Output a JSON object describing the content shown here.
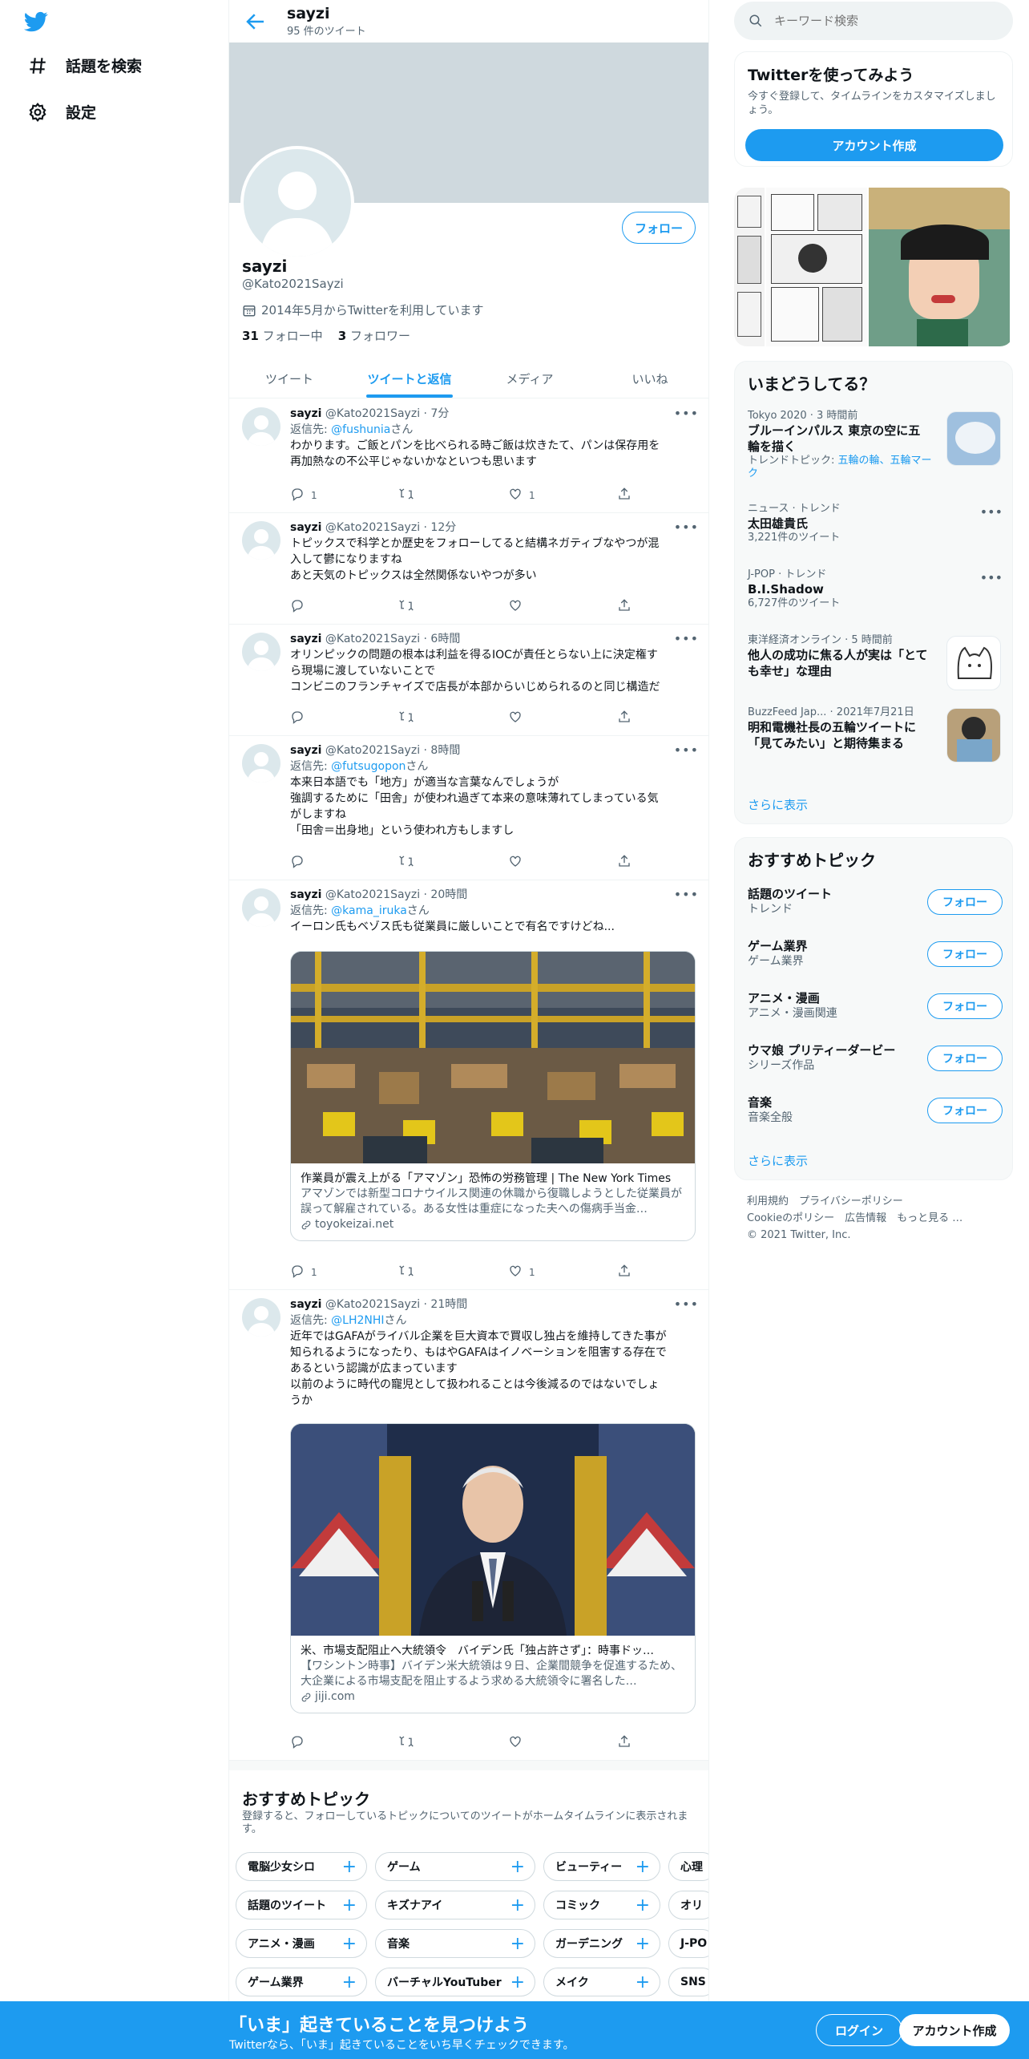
{
  "nav": {
    "explore": "話題を検索",
    "settings": "設定"
  },
  "header": {
    "name": "sayzi",
    "tweet_count": "95 件のツイート"
  },
  "profile": {
    "follow": "フォロー",
    "name": "sayzi",
    "handle": "@Kato2021Sayzi",
    "joined": "2014年5月からTwitterを利用しています",
    "following_count": "31",
    "following_label": "フォロー中",
    "followers_count": "3",
    "followers_label": "フォロワー"
  },
  "tabs": [
    "ツイート",
    "ツイートと返信",
    "メディア",
    "いいね"
  ],
  "tweets": [
    {
      "name": "sayzi",
      "meta": "@Kato2021Sayzi · 7分",
      "reply_prefix": "返信先: ",
      "reply_handle": "@fushunia",
      "reply_suffix": "さん",
      "text": "わかります。ご飯とパンを比べられる時ご飯は炊きたて、パンは保存用を\n再加熱なの不公平じゃないかなといつも思います",
      "replies": "1",
      "retweets": "",
      "likes": "1"
    },
    {
      "name": "sayzi",
      "meta": "@Kato2021Sayzi · 12分",
      "reply_prefix": "",
      "reply_handle": "",
      "reply_suffix": "",
      "text": "トピックスで科学とか歴史をフォローしてると結構ネガティブなやつが混\n入して鬱になりますね\nあと天気のトピックスは全然関係ないやつが多い",
      "replies": "",
      "retweets": "",
      "likes": ""
    },
    {
      "name": "sayzi",
      "meta": "@Kato2021Sayzi · 6時間",
      "reply_prefix": "",
      "reply_handle": "",
      "reply_suffix": "",
      "text": "オリンピックの問題の根本は利益を得るIOCが責任とらない上に決定権す\nら現場に渡していないことで\nコンビニのフランチャイズで店長が本部からいじめられるのと同じ構造だ",
      "replies": "",
      "retweets": "",
      "likes": ""
    },
    {
      "name": "sayzi",
      "meta": "@Kato2021Sayzi · 8時間",
      "reply_prefix": "返信先: ",
      "reply_handle": "@futsugopon",
      "reply_suffix": "さん",
      "text": "本来日本語でも「地方」が適当な言葉なんでしょうが\n強調するために「田舎」が使われ過ぎて本来の意味薄れてしまっている気\nがしますね\n「田舎＝出身地」という使われ方もしますし",
      "replies": "",
      "retweets": "",
      "likes": ""
    },
    {
      "name": "sayzi",
      "meta": "@Kato2021Sayzi · 20時間",
      "reply_prefix": "返信先: ",
      "reply_handle": "@kama_iruka",
      "reply_suffix": "さん",
      "text": "イーロン氏もベゾス氏も従業員に厳しいことで有名ですけどね...",
      "replies": "1",
      "retweets": "",
      "likes": "1",
      "card": {
        "title": "作業員が震え上がる「アマゾン」恐怖の労務管理 | The New York Times",
        "desc": "アマゾンでは新型コロナウイルス関連の休職から復職しようとした従業員が誤って解雇されている。ある女性は重症になった夫への傷病手当金…",
        "domain": "toyokeizai.net"
      }
    },
    {
      "name": "sayzi",
      "meta": "@Kato2021Sayzi · 21時間",
      "reply_prefix": "返信先: ",
      "reply_handle": "@LH2NHI",
      "reply_suffix": "さん",
      "text": "近年ではGAFAがライバル企業を巨大資本で買収し独占を維持してきた事が\n知られるようになったり、もはやGAFAはイノベーションを阻害する存在で\nあるという認識が広まっています\n以前のように時代の寵児として扱われることは今後減るのではないでしょ\nうか",
      "replies": "",
      "retweets": "",
      "likes": "",
      "card": {
        "title": "米、市場支配阻止へ大統領令　バイデン氏「独占許さず」：時事ドッ…",
        "desc": "【ワシントン時事】バイデン米大統領は９日、企業間競争を促進するため、大企業による市場支配を阻止するよう求める大統領令に署名した…",
        "domain": "jiji.com"
      }
    }
  ],
  "topics": {
    "title": "おすすめトピック",
    "subtitle": "登録すると、フォローしているトピックについてのツイートがホームタイムラインに表示されます。",
    "rows": [
      [
        "電脳少女シロ",
        "ゲーム",
        "ビューティー",
        "心理"
      ],
      [
        "話題のツイート",
        "キズナアイ",
        "コミック",
        "オリ"
      ],
      [
        "アニメ・漫画",
        "音楽",
        "ガーデニング",
        "J-PO"
      ],
      [
        "ゲーム業界",
        "バーチャルYouTuber",
        "メイク",
        "SNS"
      ]
    ]
  },
  "search": {
    "placeholder": "キーワード検索"
  },
  "signup_panel": {
    "title": "Twitterを使ってみよう",
    "desc": "今すぐ登録して、タイムラインをカスタマイズしましょう。",
    "button": "アカウント作成"
  },
  "trends": {
    "title": "いまどうしてる？",
    "items": [
      {
        "meta": "Tokyo 2020 · 3 時間前",
        "name": "ブルーインパルス 東京の空に五輪を描く",
        "sub_prefix": "トレンドトピック: ",
        "sub_link": "五輪の輪、五輪マーク",
        "sub": ""
      },
      {
        "meta": "ニュース · トレンド",
        "name": "太田雄貴氏",
        "sub_prefix": "",
        "sub_link": "",
        "sub": "3,221件のツイート"
      },
      {
        "meta": "J-POP · トレンド",
        "name": "B.I.Shadow",
        "sub_prefix": "",
        "sub_link": "",
        "sub": "6,727件のツイート"
      },
      {
        "meta": "東洋経済オンライン · 5 時間前",
        "name": "他人の成功に焦る人が実は「とても幸せ」な理由",
        "sub_prefix": "",
        "sub_link": "",
        "sub": ""
      },
      {
        "meta": "BuzzFeed Jap... · 2021年7月21日",
        "name": "明和電機社長の五輪ツイートに「見てみたい」と期待集まる",
        "sub_prefix": "",
        "sub_link": "",
        "sub": ""
      }
    ],
    "more": "さらに表示"
  },
  "rec_topics": {
    "title": "おすすめトピック",
    "items": [
      {
        "name": "話題のツイート",
        "sub": "トレンド"
      },
      {
        "name": "ゲーム業界",
        "sub": "ゲーム業界"
      },
      {
        "name": "アニメ・漫画",
        "sub": "アニメ・漫画関連"
      },
      {
        "name": "ウマ娘 プリティーダービー",
        "sub": "シリーズ作品"
      },
      {
        "name": "音楽",
        "sub": "音楽全般"
      }
    ],
    "follow": "フォロー",
    "more": "さらに表示"
  },
  "footer": {
    "line1": "利用規約　プライバシーポリシー",
    "line2": "Cookieのポリシー　広告情報　もっと見る …",
    "line3": "© 2021 Twitter, Inc."
  },
  "bottom_bar": {
    "title": "「いま」起きていることを見つけよう",
    "subtitle": "Twitterなら、「いま」起きていることをいち早くチェックできます。",
    "login": "ログイン",
    "signup": "アカウント作成"
  },
  "colors": {
    "accent": "#1d9bf0",
    "text": "#0f1419",
    "secondary": "#536471"
  }
}
